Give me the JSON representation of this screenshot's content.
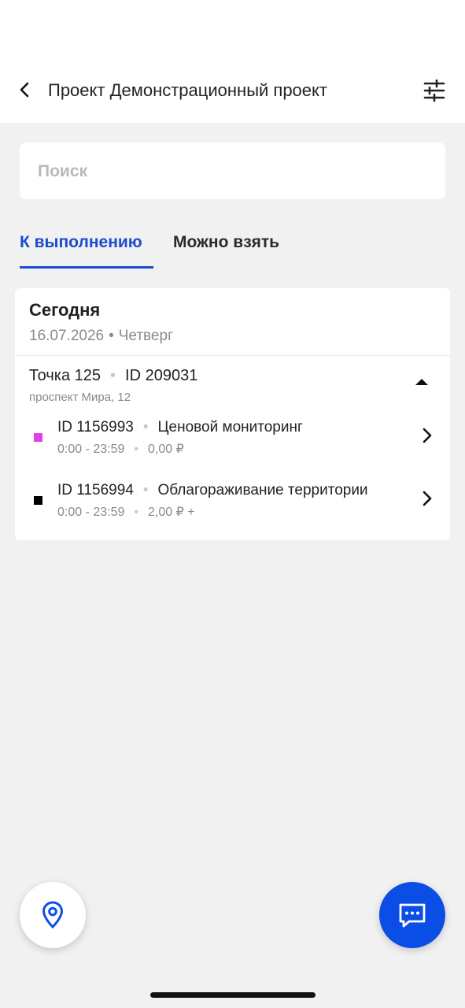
{
  "header": {
    "title": "Проект Демонстрационный проект",
    "back_icon": "chevron-left-icon",
    "filter_icon": "sliders-icon"
  },
  "search": {
    "placeholder": "Поиск",
    "value": ""
  },
  "tabs": [
    {
      "label": "К выполнению",
      "active": true
    },
    {
      "label": "Можно взять",
      "active": false
    }
  ],
  "day": {
    "title": "Сегодня",
    "date": "16.07.2026",
    "separator": "•",
    "weekday": "Четверг"
  },
  "point": {
    "name": "Точка 125",
    "separator": "•",
    "id": "ID 209031",
    "address": "проспект Мира, 12",
    "expanded_icon": "caret-up-icon"
  },
  "tasks": [
    {
      "id": "ID 1156993",
      "separator": "•",
      "title": "Ценовой мониторинг",
      "time": "0:00 - 23:59",
      "price": "0,00 ₽",
      "marker_color": "#e040e8"
    },
    {
      "id": "ID 1156994",
      "separator": "•",
      "title": "Облагораживание территории",
      "time": "0:00 - 23:59",
      "price": "2,00 ₽ +",
      "marker_color": "#000000"
    }
  ],
  "fabs": {
    "map_icon": "map-pin-icon",
    "chat_icon": "chat-icon"
  },
  "colors": {
    "accent": "#1a4bd0",
    "fab": "#0b4ee6",
    "background": "#f1f1f1"
  }
}
